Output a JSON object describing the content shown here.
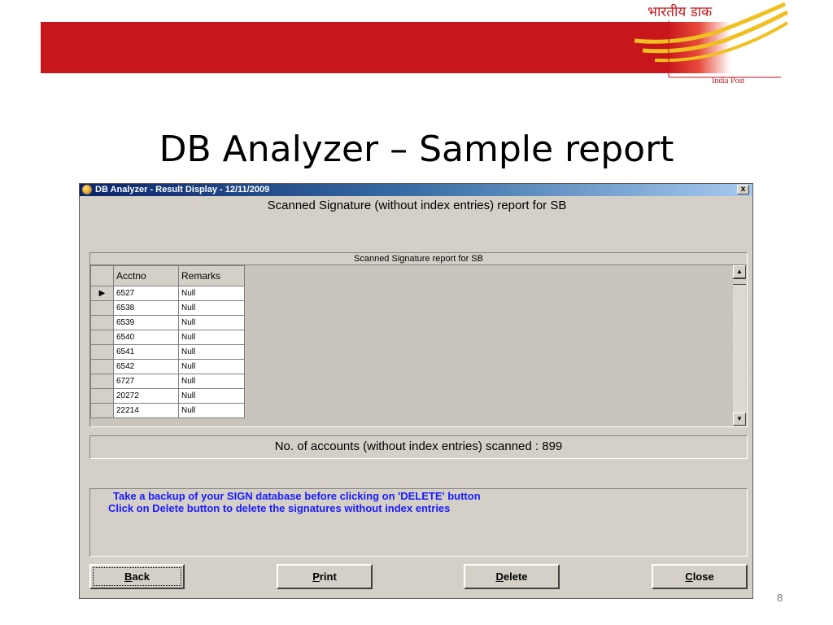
{
  "slide": {
    "title": "DB Analyzer – Sample report",
    "page_number": "8",
    "logo": {
      "hindi_text": "भारतीय डाक",
      "english_text": "India Post",
      "brand_color": "#c8161d"
    }
  },
  "window": {
    "title": "DB Analyzer - Result Display - 12/11/2009",
    "close_label": "x",
    "report_heading": "Scanned Signature (without index entries) report for SB",
    "grid": {
      "caption": "Scanned Signature report for SB",
      "columns": [
        "Acctno",
        "Remarks"
      ],
      "selected_row": 0,
      "rows": [
        [
          "6527",
          "Null"
        ],
        [
          "6538",
          "Null"
        ],
        [
          "6539",
          "Null"
        ],
        [
          "6540",
          "Null"
        ],
        [
          "6541",
          "Null"
        ],
        [
          "6542",
          "Null"
        ],
        [
          "6727",
          "Null"
        ],
        [
          "20272",
          "Null"
        ],
        [
          "22214",
          "Null"
        ]
      ]
    },
    "count_text": "No. of accounts (without index entries) scanned : 899",
    "messages": [
      "Take a backup of your SIGN database before clicking on 'DELETE' button",
      "Click on Delete button to delete the signatures without index entries"
    ],
    "buttons": {
      "back": {
        "accel": "B",
        "rest": "ack"
      },
      "print": {
        "accel": "P",
        "rest": "rint"
      },
      "delete": {
        "accel": "D",
        "rest": "elete"
      },
      "close": {
        "accel": "C",
        "rest": "lose"
      }
    }
  }
}
